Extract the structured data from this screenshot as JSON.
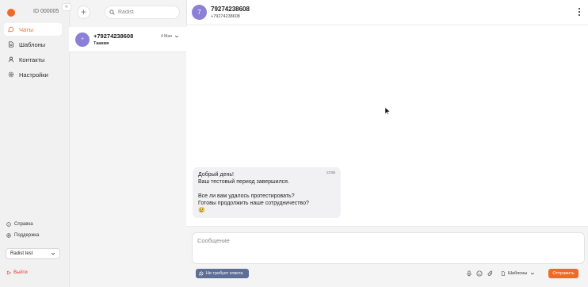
{
  "brand": {
    "accent": "#f06a26",
    "avatar_color": "#8b7fd8"
  },
  "sidebar": {
    "account_id": "ID 000005",
    "collapse_icon": "chevrons-left-icon",
    "items": [
      {
        "label": "Чаты",
        "icon": "chat-bubble-icon",
        "active": true
      },
      {
        "label": "Шаблоны",
        "icon": "document-icon",
        "active": false
      },
      {
        "label": "Контакты",
        "icon": "user-icon",
        "active": false
      },
      {
        "label": "Настройки",
        "icon": "gear-icon",
        "active": false
      }
    ],
    "help_label": "Справка",
    "support_label": "Поддержка",
    "workspace": "Radist test",
    "logout_label": "Выйти"
  },
  "chat_list": {
    "add_icon": "plus-icon",
    "search_placeholder": "Radist",
    "items": [
      {
        "avatar": "+",
        "name": "+79274238608",
        "preview": "Тааввв",
        "date": "4 Мая"
      }
    ]
  },
  "conversation": {
    "avatar": "7",
    "title": "79274238608",
    "phone": "+79274238608",
    "messages": [
      {
        "text": "Добрый день!\nВаш тестовый период завершился.\n\nВсе ли вам удалось протестировать?\nГотовы продолжить наше сотрудничество?\n😢",
        "time": "13:55"
      }
    ]
  },
  "composer": {
    "placeholder": "Сообщение",
    "no_reply_label": "Не требует ответа",
    "templates_label": "Шаблоны",
    "send_label": "Отправить"
  }
}
